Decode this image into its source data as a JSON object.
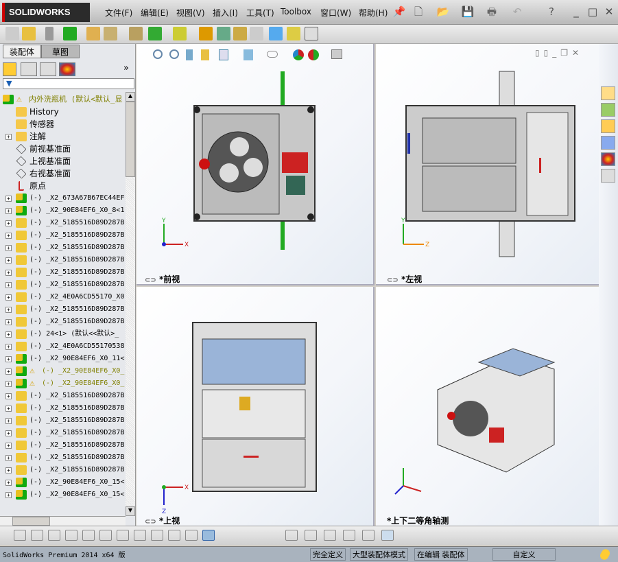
{
  "app": {
    "logo": "SOLIDWORKS"
  },
  "menu": [
    "文件(F)",
    "编辑(E)",
    "视图(V)",
    "插入(I)",
    "工具(T)",
    "Toolbox",
    "窗口(W)",
    "帮助(H)"
  ],
  "left_panel": {
    "tabs": [
      "装配体",
      "草图"
    ],
    "active_tab": 0,
    "expand_label": "»"
  },
  "tree": [
    {
      "text": "内外洗瓶机  (默认<默认_显",
      "warn": true,
      "root": true,
      "icon": "assembly-icon"
    },
    {
      "text": "History",
      "icon": "history-icon"
    },
    {
      "text": "传感器",
      "icon": "sensor-icon"
    },
    {
      "text": "注解",
      "icon": "annotation-icon",
      "exp": true
    },
    {
      "text": "前视基准面",
      "icon": "plane-icon"
    },
    {
      "text": "上视基准面",
      "icon": "plane-icon"
    },
    {
      "text": "右视基准面",
      "icon": "plane-icon"
    },
    {
      "text": "原点",
      "icon": "origin-icon"
    },
    {
      "text": "(-) _X2_673A67B67EC44EF",
      "icon": "subassembly-icon",
      "exp": true
    },
    {
      "text": "(-) _X2_90E84EF6_X0_8<1",
      "icon": "subassembly-icon",
      "exp": true
    },
    {
      "text": "(-) _X2_5185516D89D287B",
      "icon": "part-icon",
      "exp": true
    },
    {
      "text": "(-) _X2_5185516D89D287B",
      "icon": "part-icon",
      "exp": true
    },
    {
      "text": "(-) _X2_5185516D89D287B",
      "icon": "part-icon",
      "exp": true
    },
    {
      "text": "(-) _X2_5185516D89D287B",
      "icon": "part-icon",
      "exp": true
    },
    {
      "text": "(-) _X2_5185516D89D287B",
      "icon": "part-icon",
      "exp": true
    },
    {
      "text": "(-) _X2_5185516D89D287B",
      "icon": "part-icon",
      "exp": true
    },
    {
      "text": "(-) _X2_4E0A6CD55170_X0",
      "icon": "part-icon",
      "exp": true
    },
    {
      "text": "(-) _X2_5185516D89D287B",
      "icon": "part-icon",
      "exp": true
    },
    {
      "text": "(-) _X2_5185516D89D287B",
      "icon": "part-icon",
      "exp": true
    },
    {
      "text": "(-) 24<1> (默认<<默认>_",
      "icon": "part-icon",
      "exp": true
    },
    {
      "text": "(-) _X2_4E0A6CD55170538",
      "icon": "part-icon",
      "exp": true
    },
    {
      "text": "(-) _X2_90E84EF6_X0_11<",
      "icon": "subassembly-icon",
      "exp": true
    },
    {
      "text": "(-) _X2_90E84EF6_X0_",
      "icon": "subassembly-icon",
      "exp": true,
      "warn": true
    },
    {
      "text": "(-) _X2_90E84EF6_X0_",
      "icon": "subassembly-icon",
      "exp": true,
      "warn": true
    },
    {
      "text": "(-) _X2_5185516D89D287B",
      "icon": "part-icon",
      "exp": true
    },
    {
      "text": "(-) _X2_5185516D89D287B",
      "icon": "part-icon",
      "exp": true
    },
    {
      "text": "(-) _X2_5185516D89D287B",
      "icon": "part-icon",
      "exp": true
    },
    {
      "text": "(-) _X2_5185516D89D287B",
      "icon": "part-icon",
      "exp": true
    },
    {
      "text": "(-) _X2_5185516D89D287B",
      "icon": "part-icon",
      "exp": true
    },
    {
      "text": "(-) _X2_5185516D89D287B",
      "icon": "part-icon",
      "exp": true
    },
    {
      "text": "(-) _X2_5185516D89D287B",
      "icon": "part-icon",
      "exp": true
    },
    {
      "text": "(-) _X2_90E84EF6_X0_15<",
      "icon": "subassembly-icon",
      "exp": true
    },
    {
      "text": "(-) _X2_90E84EF6_X0_15<",
      "icon": "subassembly-icon",
      "exp": true
    }
  ],
  "viewports": [
    "*前视",
    "*左视",
    "*上视",
    "*上下二等角轴测"
  ],
  "axes": {
    "x": "X",
    "y": "Y",
    "z": "Z"
  },
  "status": {
    "version": "SolidWorks Premium 2014 x64 版",
    "fully_defined": "完全定义",
    "large_assembly": "大型装配体模式",
    "editing": "在编辑 装配体",
    "units": "自定义"
  },
  "colors": {
    "warning_text": "#808000",
    "accent_red": "#cc1111"
  }
}
